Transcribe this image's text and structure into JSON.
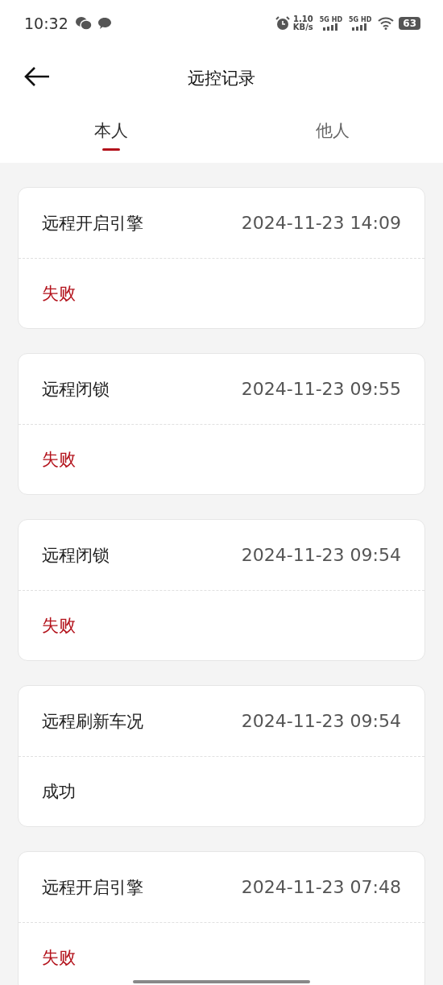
{
  "status_bar": {
    "time": "10:32",
    "speed": "1.10",
    "speed_unit": "KB/s",
    "sim_labels": [
      "5G HD",
      "5G HD"
    ],
    "battery": "63"
  },
  "header": {
    "title": "远控记录"
  },
  "tabs": [
    {
      "label": "本人",
      "selected": true
    },
    {
      "label": "他人",
      "selected": false
    }
  ],
  "records": [
    {
      "action": "远程开启引擎",
      "time": "2024-11-23 14:09",
      "result": "失败",
      "kind": "failure"
    },
    {
      "action": "远程闭锁",
      "time": "2024-11-23 09:55",
      "result": "失败",
      "kind": "failure"
    },
    {
      "action": "远程闭锁",
      "time": "2024-11-23 09:54",
      "result": "失败",
      "kind": "failure"
    },
    {
      "action": "远程刷新车况",
      "time": "2024-11-23 09:54",
      "result": "成功",
      "kind": "success"
    },
    {
      "action": "远程开启引擎",
      "time": "2024-11-23 07:48",
      "result": "失败",
      "kind": "failure"
    }
  ]
}
